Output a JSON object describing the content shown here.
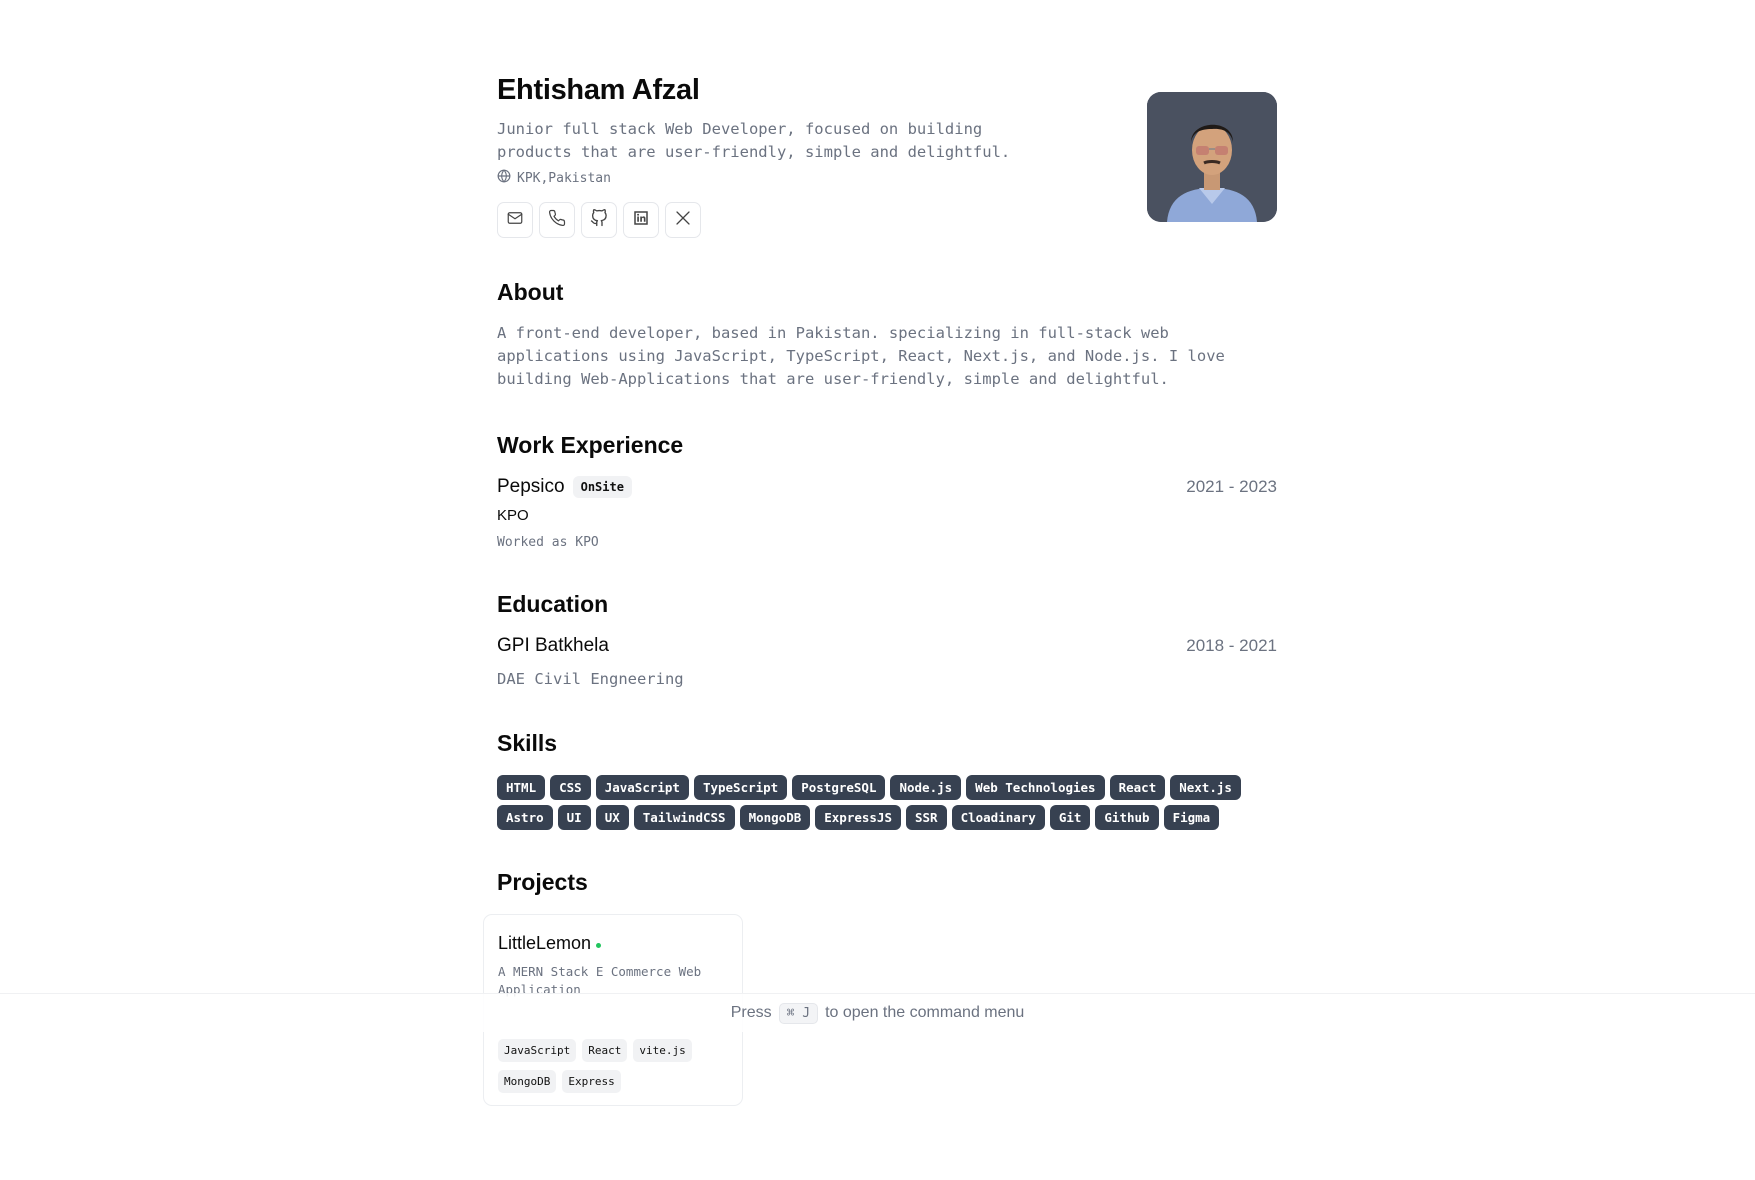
{
  "profile": {
    "name": "Ehtisham Afzal",
    "tagline": "Junior full stack Web Developer, focused on building products that are user-friendly, simple and delightful.",
    "location": "KPK,Pakistan",
    "contacts": [
      {
        "icon": "mail-icon"
      },
      {
        "icon": "phone-icon"
      },
      {
        "icon": "github-icon"
      },
      {
        "icon": "linkedin-icon"
      },
      {
        "icon": "x-icon"
      }
    ]
  },
  "about": {
    "title": "About",
    "text": "A front-end developer, based in Pakistan. specializing in full-stack web applications using JavaScript, TypeScript, React, Next.js, and Node.js. I love building Web-Applications that are user-friendly, simple and delightful."
  },
  "work": {
    "title": "Work Experience",
    "items": [
      {
        "company": "Pepsico",
        "badge": "OnSite",
        "dates": "2021 - 2023",
        "role": "KPO",
        "description": "Worked as KPO"
      }
    ]
  },
  "education": {
    "title": "Education",
    "items": [
      {
        "school": "GPI Batkhela",
        "dates": "2018 - 2021",
        "degree": "DAE Civil Engneering"
      }
    ]
  },
  "skills": {
    "title": "Skills",
    "items": [
      "HTML",
      "CSS",
      "JavaScript",
      "TypeScript",
      "PostgreSQL",
      "Node.js",
      "Web Technologies",
      "React",
      "Next.js",
      "Astro",
      "UI",
      "UX",
      "TailwindCSS",
      "MongoDB",
      "ExpressJS",
      "SSR",
      "Cloadinary",
      "Git",
      "Github",
      "Figma"
    ]
  },
  "projects": {
    "title": "Projects",
    "items": [
      {
        "title": "LittleLemon",
        "description": "A MERN Stack E Commerce Web Application",
        "tags": [
          "JavaScript",
          "React",
          "vite.js",
          "MongoDB",
          "Express"
        ]
      }
    ]
  },
  "command_bar": {
    "press": "Press",
    "shortcut": "⌘ J",
    "suffix": "to open the command menu"
  },
  "colors": {
    "skill_badge_bg": "#374151",
    "muted_text": "#6b7280",
    "status_dot": "#22c55e"
  }
}
